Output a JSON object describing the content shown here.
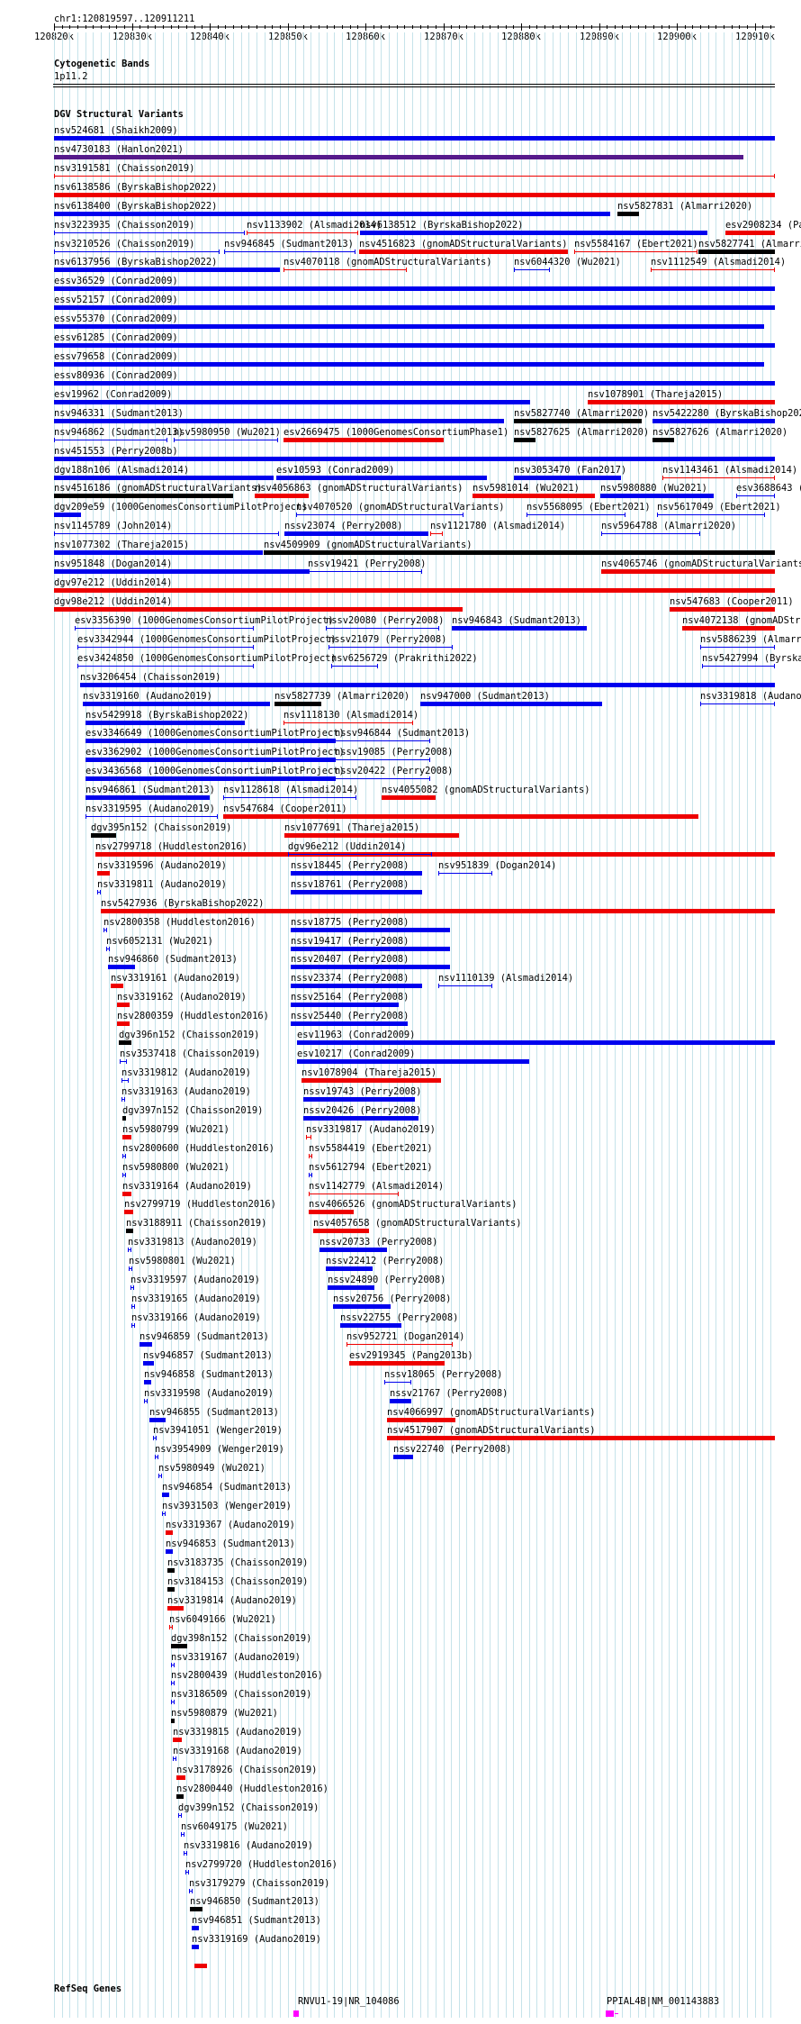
{
  "position": "chr1:120819597..120911211",
  "ruler_labels": [
    "120820k",
    "120830k",
    "120840k",
    "120850k",
    "120860k",
    "120870k",
    "120880k",
    "120890k",
    "120900k",
    "120910k"
  ],
  "tracks": {
    "cytobands": {
      "title": "Cytogenetic Bands",
      "band": "1p11.2"
    },
    "dgv": {
      "title": "DGV Structural Variants"
    },
    "refseq": {
      "title": "RefSeq Genes",
      "genes": [
        "RNVU1-19|NR_104086",
        "PPIAL4B|NM_001143883"
      ]
    }
  },
  "colors": {
    "gain": "#0000ee",
    "loss": "#ee0000",
    "complex": "#000000",
    "inversion": "#551a8b",
    "gene": "#ff00ff"
  },
  "variant_labels": [
    "nsv524681 (Shaikh2009)",
    "nsv4730183 (Hanlon2021)",
    "nsv3191581 (Chaisson2019)",
    "nsv6138586 (ByrskaBishop2022)",
    "nsv6138400 (ByrskaBishop2022)",
    "nsv5827831 (Almarri2020)",
    "nsv3223935 (Chaisson2019)",
    "nsv1133902 (Alsmadi2014)",
    "nsv6138512 (ByrskaBishop2022)",
    "esv2908234 (Pa",
    "nsv3210526 (Chaisson2019)",
    "nsv946845 (Sudmant2013)",
    "nsv4516823 (gnomADStructuralVariants)",
    "nsv5584167 (Ebert2021)",
    "nsv5827741 (Almarri2",
    "nsv6137956 (ByrskaBishop2022)",
    "nsv4070118 (gnomADStructuralVariants)",
    "nsv6044320 (Wu2021)",
    "nsv1112549 (Alsmadi2014)",
    "essv36529 (Conrad2009)",
    "essv52157 (Conrad2009)",
    "essv55370 (Conrad2009)",
    "essv61285 (Conrad2009)",
    "essv79658 (Conrad2009)",
    "essv80936 (Conrad2009)",
    "esv19962 (Conrad2009)",
    "nsv1078901 (Thareja2015)",
    "nsv946331 (Sudmant2013)",
    "nsv5827740 (Almarri2020)",
    "nsv5422280 (ByrskaBishop2022",
    "nsv946862 (Sudmant2013)",
    "nsv5980950 (Wu2021)",
    "esv2669475 (1000GenomesConsortiumPhase1)",
    "nsv5827625 (Almarri2020)",
    "nsv5827626 (Almarri2020)",
    "nsv451553 (Perry2008b)",
    "dgv188n106 (Alsmadi2014)",
    "esv10593 (Conrad2009)",
    "nsv3053470 (Fan2017)",
    "nsv1143461 (Alsmadi2014)",
    "nsv4516186 (gnomADStructuralVariants)",
    "nsv4056863 (gnomADStructuralVariants)",
    "nsv5981014 (Wu2021)",
    "nsv5980880 (Wu2021)",
    "esv3688643 (",
    "dgv209e59 (1000GenomesConsortiumPilotProject)",
    "nsv4070520 (gnomADStructuralVariants)",
    "nsv5568095 (Ebert2021)",
    "nsv5617049 (Ebert2021)",
    "nsv1145789 (John2014)",
    "nssv23074 (Perry2008)",
    "nsv1121780 (Alsmadi2014)",
    "nsv5964788 (Almarri2020)",
    "nsv1077302 (Thareja2015)",
    "nsv4509909 (gnomADStructuralVariants)",
    "nsv951848 (Dogan2014)",
    "nssv19421 (Perry2008)",
    "nsv4065746 (gnomADStructuralVariants",
    "dgv97e212 (Uddin2014)",
    "dgv98e212 (Uddin2014)",
    "nsv547683 (Cooper2011)",
    "esv3356390 (1000GenomesConsortiumPilotProject)",
    "nssv20080 (Perry2008)",
    "nsv946843 (Sudmant2013)",
    "nsv4072138 (gnomADStru",
    "esv3342944 (1000GenomesConsortiumPilotProject)",
    "nssv21079 (Perry2008)",
    "nsv5886239 (Almarr",
    "esv3424850 (1000GenomesConsortiumPilotProject)",
    "nsv6256729 (Prakrithi2022)",
    "nsv5427994 (Byrska",
    "nsv3206454 (Chaisson2019)",
    "nsv3319160 (Audano2019)",
    "nsv5827739 (Almarri2020)",
    "nsv947000 (Sudmant2013)",
    "nsv3319818 (Audano",
    "nsv5429918 (ByrskaBishop2022)",
    "nsv1118130 (Alsmadi2014)",
    "esv3346649 (1000GenomesConsortiumPilotProject)",
    "nssv946844 (Sudmant2013)",
    "esv3362902 (1000GenomesConsortiumPilotProject)",
    "nssv19085 (Perry2008)",
    "esv3436568 (1000GenomesConsortiumPilotProject)",
    "nssv20422 (Perry2008)",
    "nsv946861 (Sudmant2013)",
    "nsv1128618 (Alsmadi2014)",
    "nsv4055082 (gnomADStructuralVariants)",
    "nsv3319595 (Audano2019)",
    "nsv547684 (Cooper2011)",
    "dgv395n152 (Chaisson2019)",
    "nsv1077691 (Thareja2015)",
    "nsv2799718 (Huddleston2016)",
    "dgv96e212 (Uddin2014)",
    "nsv3319596 (Audano2019)",
    "nssv18445 (Perry2008)",
    "nsv951839 (Dogan2014)",
    "nsv3319811 (Audano2019)",
    "nssv18761 (Perry2008)",
    "nsv5427936 (ByrskaBishop2022)",
    "nsv2800358 (Huddleston2016)",
    "nssv18775 (Perry2008)",
    "nsv6052131 (Wu2021)",
    "nssv19417 (Perry2008)",
    "nsv946860 (Sudmant2013)",
    "nssv20407 (Perry2008)",
    "nsv3319161 (Audano2019)",
    "nssv23374 (Perry2008)",
    "nsv1110139 (Alsmadi2014)",
    "nsv3319162 (Audano2019)",
    "nssv25164 (Perry2008)",
    "nsv2800359 (Huddleston2016)",
    "nssv25440 (Perry2008)",
    "dgv396n152 (Chaisson2019)",
    "esv11963 (Conrad2009)",
    "nsv3537418 (Chaisson2019)",
    "esv10217 (Conrad2009)",
    "nsv3319812 (Audano2019)",
    "nsv1078904 (Thareja2015)",
    "nsv3319163 (Audano2019)",
    "nssv19743 (Perry2008)",
    "dgv397n152 (Chaisson2019)",
    "nssv20426 (Perry2008)",
    "nsv5980799 (Wu2021)",
    "nsv3319817 (Audano2019)",
    "nsv2800600 (Huddleston2016)",
    "nsv5584419 (Ebert2021)",
    "nsv5980800 (Wu2021)",
    "nsv5612794 (Ebert2021)",
    "nsv3319164 (Audano2019)",
    "nsv1142779 (Alsmadi2014)",
    "nsv2799719 (Huddleston2016)",
    "nsv4066526 (gnomADStructuralVariants)",
    "nsv3188911 (Chaisson2019)",
    "nsv4057658 (gnomADStructuralVariants)",
    "nsv3319813 (Audano2019)",
    "nssv20733 (Perry2008)",
    "nsv5980801 (Wu2021)",
    "nssv22412 (Perry2008)",
    "nsv3319597 (Audano2019)",
    "nssv24890 (Perry2008)",
    "nsv3319165 (Audano2019)",
    "nssv20756 (Perry2008)",
    "nsv3319166 (Audano2019)",
    "nssv22755 (Perry2008)",
    "nsv946859 (Sudmant2013)",
    "nsv952721 (Dogan2014)",
    "nsv946857 (Sudmant2013)",
    "esv2919345 (Pang2013b)",
    "nsv946858 (Sudmant2013)",
    "nssv18065 (Perry2008)",
    "nsv3319598 (Audano2019)",
    "nssv21767 (Perry2008)",
    "nsv946855 (Sudmant2013)",
    "nsv4066997 (gnomADStructuralVariants)",
    "nsv3941051 (Wenger2019)",
    "nsv4517907 (gnomADStructuralVariants)",
    "nsv3954909 (Wenger2019)",
    "nssv22740 (Perry2008)",
    "nsv5980949 (Wu2021)",
    "nsv946854 (Sudmant2013)",
    "nsv3931503 (Wenger2019)",
    "nsv3319367 (Audano2019)",
    "nsv946853 (Sudmant2013)",
    "nsv3183735 (Chaisson2019)",
    "nsv3184153 (Chaisson2019)",
    "nsv3319814 (Audano2019)",
    "nsv6049166 (Wu2021)",
    "dgv398n152 (Chaisson2019)",
    "nsv3319167 (Audano2019)",
    "nsv2800439 (Huddleston2016)",
    "nsv3186509 (Chaisson2019)",
    "nsv5980879 (Wu2021)",
    "nsv3319815 (Audano2019)",
    "nsv3319168 (Audano2019)",
    "nsv3178926 (Chaisson2019)",
    "nsv2800440 (Huddleston2016)",
    "dgv399n152 (Chaisson2019)",
    "nsv6049175 (Wu2021)",
    "nsv3319816 (Audano2019)",
    "nsv2799720 (Huddleston2016)",
    "nsv3179279 (Chaisson2019)",
    "nsv946850 (Sudmant2013)",
    "nsv946851 (Sudmant2013)",
    "nsv3319169 (Audano2019)"
  ]
}
